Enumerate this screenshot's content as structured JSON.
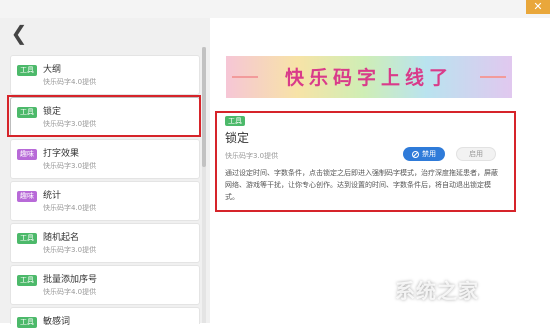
{
  "window": {
    "close_glyph": "✕"
  },
  "nav": {
    "back_glyph": "❮"
  },
  "tools": [
    {
      "tag": "工具",
      "tag_color": "green",
      "title": "大纲",
      "subtitle": "快乐码字4.0提供"
    },
    {
      "tag": "工具",
      "tag_color": "green",
      "title": "锁定",
      "subtitle": "快乐码字3.0提供"
    },
    {
      "tag": "趣味",
      "tag_color": "purple",
      "title": "打字效果",
      "subtitle": "快乐码字3.0提供"
    },
    {
      "tag": "趣味",
      "tag_color": "purple",
      "title": "统计",
      "subtitle": "快乐码字4.0提供"
    },
    {
      "tag": "工具",
      "tag_color": "green",
      "title": "随机起名",
      "subtitle": "快乐码字3.0提供"
    },
    {
      "tag": "工具",
      "tag_color": "green",
      "title": "批量添加序号",
      "subtitle": "快乐码字4.0提供"
    },
    {
      "tag": "工具",
      "tag_color": "green",
      "title": "敏感词",
      "subtitle": ""
    }
  ],
  "banner": {
    "text": "快乐码字上线了"
  },
  "detail": {
    "tag": "工具",
    "title": "锁定",
    "subtitle": "快乐码字3.0提供",
    "disable_label": "禁用",
    "enable_label": "启用",
    "description": "通过设定时间、字数条件，点击锁定之后即进入强制码字模式，治疗深度拖延患者，屏蔽网络、游戏等干扰，让你专心创作。达到设置的时间、字数条件后，将自动退出锁定模式。"
  },
  "watermark": {
    "text": "系统之家"
  },
  "colors": {
    "accent": "#2f7bd9",
    "tool_tag": "#4cb96a",
    "fun_tag": "#b86ad8",
    "highlight": "#d6242a",
    "close": "#e9a73b"
  }
}
